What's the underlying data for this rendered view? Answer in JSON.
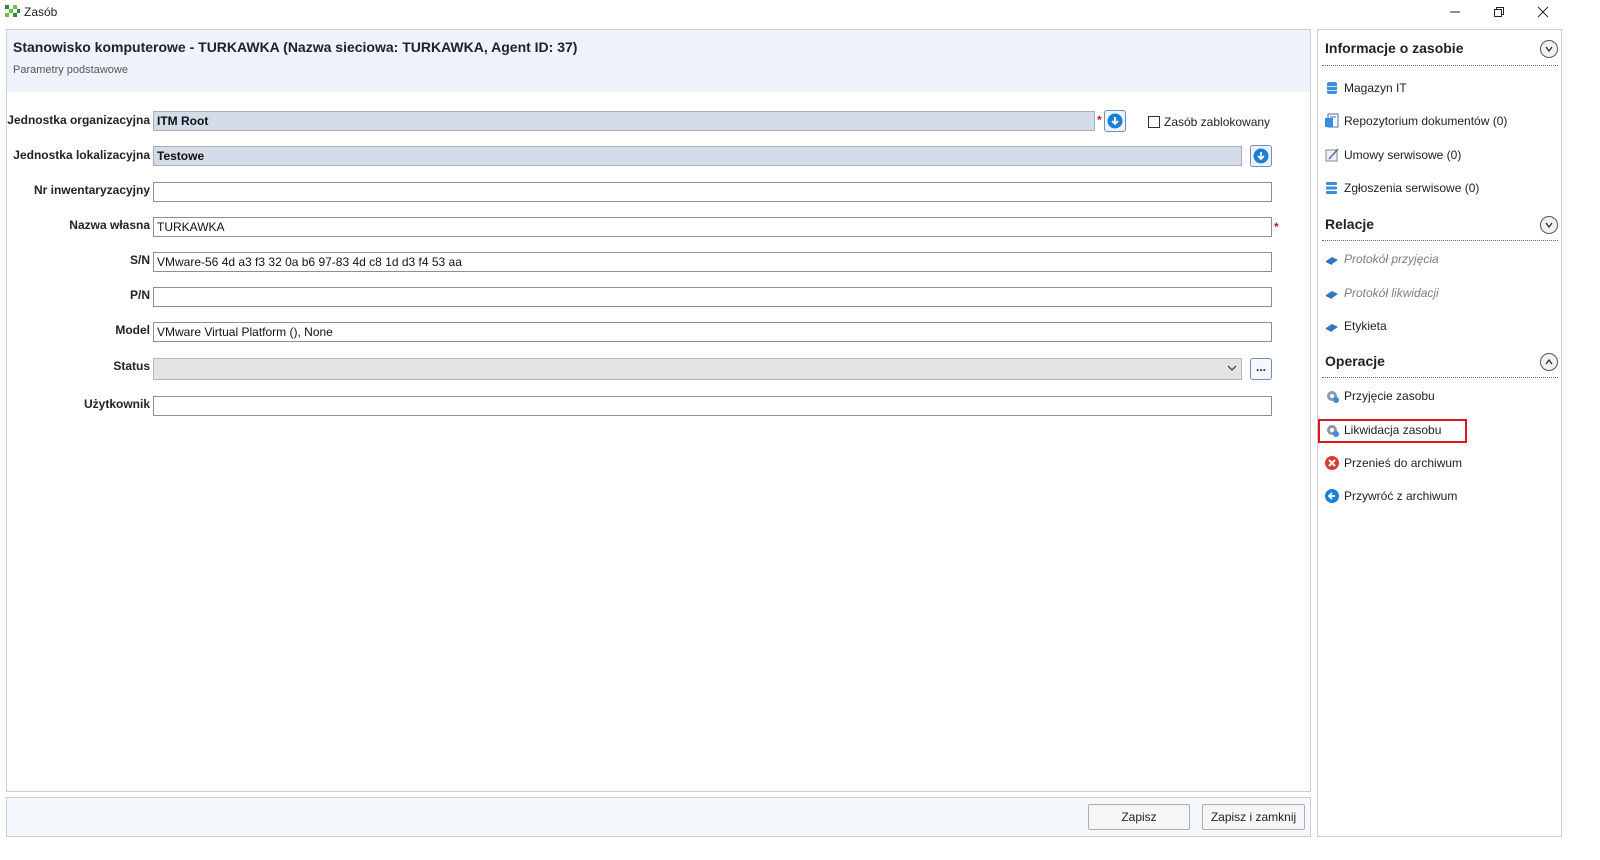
{
  "window": {
    "title": "Zasób"
  },
  "header": {
    "title": "Stanowisko komputerowe - TURKAWKA (Nazwa sieciowa: TURKAWKA, Agent ID: 37)",
    "subtitle": "Parametry podstawowe"
  },
  "form": {
    "org_unit": {
      "label": "Jednostka organizacyjna",
      "value": "ITM Root"
    },
    "blocked": {
      "label": "Zasób zablokowany",
      "checked": false
    },
    "loc_unit": {
      "label": "Jednostka lokalizacyjna",
      "value": "Testowe"
    },
    "inventory_no": {
      "label": "Nr inwentaryzacyjny",
      "value": ""
    },
    "own_name": {
      "label": "Nazwa własna",
      "value": "TURKAWKA"
    },
    "sn": {
      "label": "S/N",
      "value": "VMware-56 4d a3 f3 32 0a b6 97-83 4d c8 1d d3 f4 53 aa"
    },
    "pn": {
      "label": "P/N",
      "value": ""
    },
    "model": {
      "label": "Model",
      "value": "VMware Virtual Platform (), None"
    },
    "status": {
      "label": "Status",
      "value": ""
    },
    "user": {
      "label": "Użytkownik",
      "value": ""
    },
    "required_mark": "*",
    "dots_label": "..."
  },
  "footer": {
    "save_label": "Zapisz",
    "save_close_label": "Zapisz i zamknij"
  },
  "side": {
    "info": {
      "title": "Informacje o zasobie",
      "items": [
        "Magazyn IT",
        "Repozytorium dokumentów (0)",
        "Umowy serwisowe (0)",
        "Zgłoszenia serwisowe (0)"
      ]
    },
    "relations": {
      "title": "Relacje",
      "items": [
        "Protokół przyjęcia",
        "Protokół likwidacji",
        "Etykieta"
      ]
    },
    "operations": {
      "title": "Operacje",
      "items": [
        "Przyjęcie zasobu",
        "Likwidacja zasobu",
        "Przenieś do archiwum",
        "Przywróć z archiwum"
      ]
    }
  },
  "colors": {
    "accent": "#1c7fd6",
    "highlight": "#e0141e",
    "header_bg": "#edf2fb",
    "readonly_bg": "#d3dce8"
  }
}
